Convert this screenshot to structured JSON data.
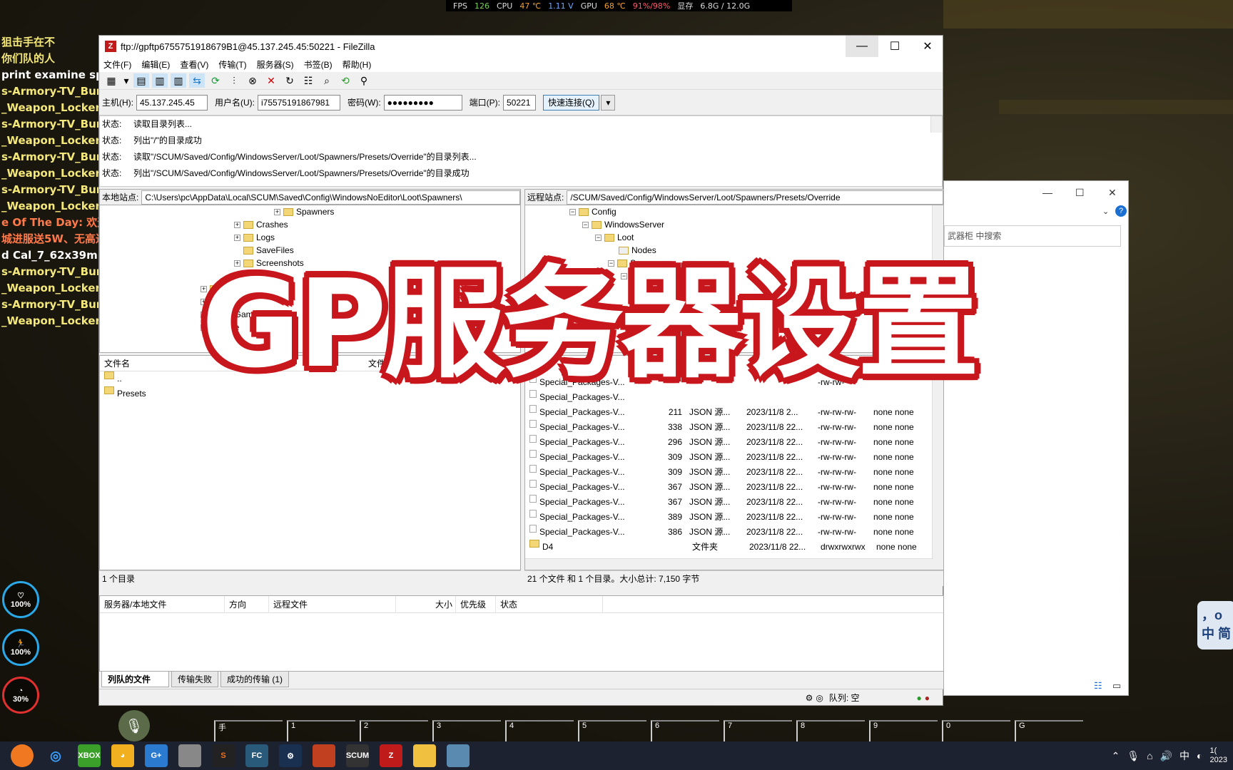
{
  "hud": {
    "fps_label": "FPS",
    "fps": "126",
    "cpu_label": "CPU",
    "cpu_temp": "47 ℃",
    "cpu_volt": "1.11 V",
    "gpu_label": "GPU",
    "gpu_temp": "68 ℃",
    "gpu_load": "91%/98%",
    "vram_label": "显存",
    "vram": "6.8G / 12.0G"
  },
  "chat": [
    "狙击手在不",
    "你们队的人",
    "print examine spaw",
    "s-Armory-TV_Bunk",
    "_Weapon_Locker_",
    "s-Armory-TV_Bunk",
    "_Weapon_Locker_",
    "s-Armory-TV_Bunk",
    "_Weapon_Locker_",
    "s-Armory-TV_Bunk",
    "_Weapon_Locker_",
    "e Of The Day: 欢迎来",
    "城进服送5W、无高达",
    "d Cal_7_62x39mm_",
    "s-Armory-TV_Bunk",
    "_Weapon_Locker_",
    "s-Armory-TV_Bunk",
    "_Weapon_Locker_"
  ],
  "stats": [
    {
      "label": "100%"
    },
    {
      "label": "100%"
    },
    {
      "label": "30%"
    }
  ],
  "window": {
    "title": "ftp://gpftp6755751918679B1@45.137.245.45:50221 - FileZilla",
    "menu": [
      "文件(F)",
      "编辑(E)",
      "查看(V)",
      "传输(T)",
      "服务器(S)",
      "书签(B)",
      "帮助(H)"
    ],
    "quickconnect": {
      "host_label": "主机(H):",
      "host": "45.137.245.45",
      "user_label": "用户名(U):",
      "user": "i75575191867981",
      "pass_label": "密码(W):",
      "pass": "●●●●●●●●●",
      "port_label": "端口(P):",
      "port": "50221",
      "button": "快速连接(Q)"
    },
    "log": [
      {
        "k": "状态:",
        "v": "读取目录列表..."
      },
      {
        "k": "状态:",
        "v": "列出\"/\"的目录成功"
      },
      {
        "k": "状态:",
        "v": "读取\"/SCUM/Saved/Config/WindowsServer/Loot/Spawners/Presets/Override\"的目录列表..."
      },
      {
        "k": "状态:",
        "v": "列出\"/SCUM/Saved/Config/WindowsServer/Loot/Spawners/Presets/Override\"的目录成功"
      }
    ],
    "local": {
      "site_label": "本地站点:",
      "path": "C:\\Users\\pc\\AppData\\Local\\SCUM\\Saved\\Config\\WindowsNoEditor\\Loot\\Spawners\\",
      "tree": [
        "Spawners",
        "Crashes",
        "Logs",
        "SaveFiles",
        "Screenshots",
        "Temp",
        "SC...Hel",
        "",
        "...dGame",
        "...ee"
      ],
      "col_name": "文件名",
      "col_size": "文件",
      "col_mod": "最",
      "files": [
        "..",
        "Presets"
      ],
      "status": "1 个目录"
    },
    "remote": {
      "site_label": "远程站点:",
      "path": "/SCUM/Saved/Config/WindowsServer/Loot/Spawners/Presets/Override",
      "tree": [
        "Config",
        "WindowsServer",
        "Loot",
        "Nodes",
        "Spawners",
        "Presets"
      ],
      "files": [
        {
          "name": "Special_Packages-V...",
          "size": "",
          "type": "",
          "date": "",
          "perm": "-rw-rw-",
          "owner": ""
        },
        {
          "name": "Special_Packages-V...",
          "size": "",
          "type": "",
          "date": "",
          "perm": "",
          "owner": ""
        },
        {
          "name": "Special_Packages-V...",
          "size": "211",
          "type": "JSON 源...",
          "date": "2023/11/8 2...",
          "perm": "-rw-rw-rw-",
          "owner": "none none"
        },
        {
          "name": "Special_Packages-V...",
          "size": "338",
          "type": "JSON 源...",
          "date": "2023/11/8 22...",
          "perm": "-rw-rw-rw-",
          "owner": "none none"
        },
        {
          "name": "Special_Packages-V...",
          "size": "296",
          "type": "JSON 源...",
          "date": "2023/11/8 22...",
          "perm": "-rw-rw-rw-",
          "owner": "none none"
        },
        {
          "name": "Special_Packages-V...",
          "size": "309",
          "type": "JSON 源...",
          "date": "2023/11/8 22...",
          "perm": "-rw-rw-rw-",
          "owner": "none none"
        },
        {
          "name": "Special_Packages-V...",
          "size": "309",
          "type": "JSON 源...",
          "date": "2023/11/8 22...",
          "perm": "-rw-rw-rw-",
          "owner": "none none"
        },
        {
          "name": "Special_Packages-V...",
          "size": "367",
          "type": "JSON 源...",
          "date": "2023/11/8 22...",
          "perm": "-rw-rw-rw-",
          "owner": "none none"
        },
        {
          "name": "Special_Packages-V...",
          "size": "367",
          "type": "JSON 源...",
          "date": "2023/11/8 22...",
          "perm": "-rw-rw-rw-",
          "owner": "none none"
        },
        {
          "name": "Special_Packages-V...",
          "size": "389",
          "type": "JSON 源...",
          "date": "2023/11/8 22...",
          "perm": "-rw-rw-rw-",
          "owner": "none none"
        },
        {
          "name": "Special_Packages-V...",
          "size": "386",
          "type": "JSON 源...",
          "date": "2023/11/8 22...",
          "perm": "-rw-rw-rw-",
          "owner": "none none"
        },
        {
          "name": "D4",
          "size": "",
          "type": "文件夹",
          "date": "2023/11/8 22...",
          "perm": "drwxrwxrwx",
          "owner": "none none"
        }
      ],
      "status": "21 个文件 和 1 个目录。大小总计: 7,150 字节"
    },
    "queue": {
      "cols": [
        "服务器/本地文件",
        "方向",
        "远程文件",
        "大小",
        "优先级",
        "状态"
      ]
    },
    "tabs": [
      "列队的文件",
      "传输失败",
      "成功的传输 (1)"
    ],
    "queue_status": "队列: 空"
  },
  "explorer": {
    "search_placeholder": "武器柜 中搜索"
  },
  "overlay": "GP服务器设置",
  "hotbar": [
    "手",
    "1",
    "2",
    "3",
    "4",
    "5",
    "6",
    "7",
    "8",
    "9",
    "0",
    "G"
  ],
  "ime": {
    "l1": "，o",
    "l2": "中 简"
  },
  "tray": {
    "lang": "中",
    "time": "1(",
    "date": "2023"
  },
  "colors": {
    "accent": "#c8161d",
    "filezilla": "#bf1b1b"
  }
}
